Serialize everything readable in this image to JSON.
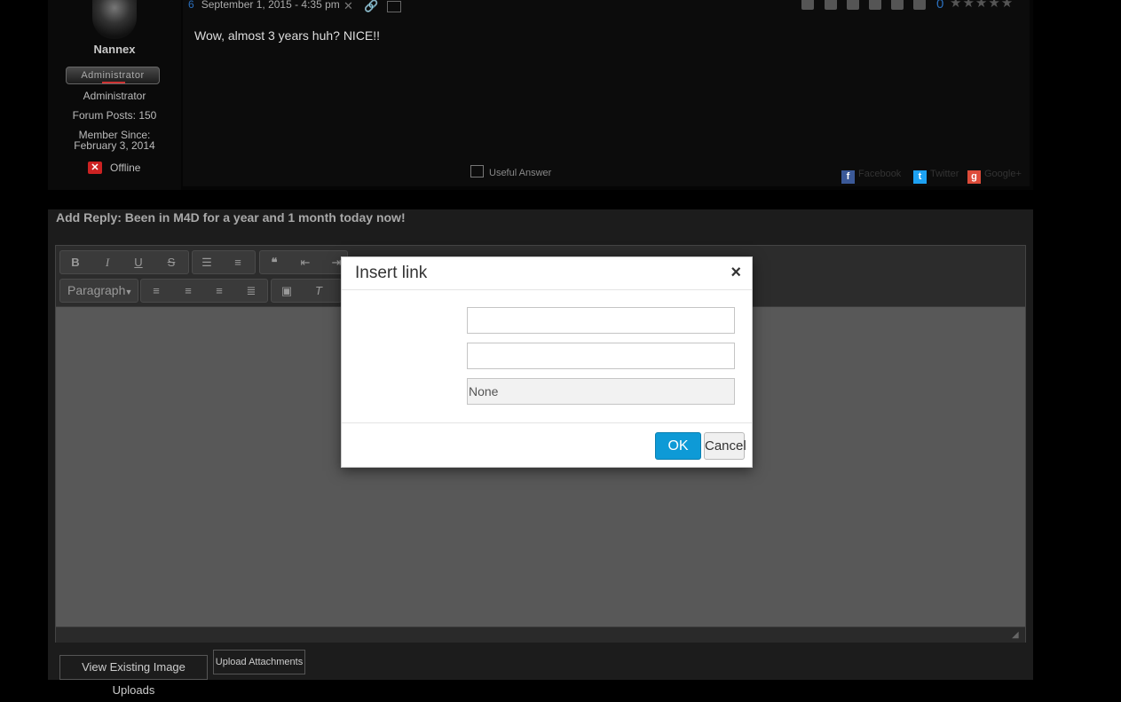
{
  "post": {
    "number": "6",
    "date": "September 1, 2015 - 4:35 pm",
    "text": "Wow, almost 3 years huh? NICE!!",
    "rating": "0",
    "stars": "★★★★★",
    "useful_answer": "Useful Answer",
    "share": [
      "Facebook",
      "Twitter",
      "Google+"
    ]
  },
  "user": {
    "name": "Nannex",
    "badge": "Administrator",
    "role": "Administrator",
    "forum_posts": "Forum Posts: 150",
    "member_since_label": "Member Since:",
    "member_since_date": "February 3, 2014",
    "status": "Offline"
  },
  "reply": {
    "title": "Add Reply: Been in M4D for a year and 1 month today now!",
    "format_select": "Paragraph",
    "view_uploads_button": "View Existing Image Uploads",
    "upload_attachments_button": "Upload Attachments"
  },
  "dialog": {
    "title": "Insert link",
    "close_glyph": "×",
    "url_value": "",
    "text_value": "",
    "target_value": "None",
    "ok_label": "OK",
    "cancel_label": "Cancel"
  },
  "colors": {
    "accent": "#0e9ad6",
    "rating": "#2a6ebb",
    "offline": "#cc2222"
  }
}
